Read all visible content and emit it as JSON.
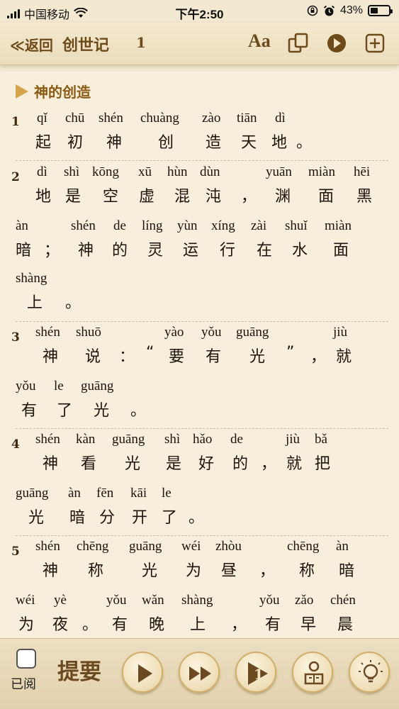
{
  "status_bar": {
    "carrier": "中国移动",
    "time": "下午2:50",
    "battery": "43%",
    "battery_level": 0.43
  },
  "nav": {
    "back_label": "≪返回",
    "book_name": "创世记",
    "chapter": "1",
    "font_label": "Aa"
  },
  "section_title": "神的创造",
  "verses": [
    {
      "num": "1",
      "lines": [
        {
          "py": [
            "qǐ",
            "chū",
            "shén",
            "chuàng",
            "zào",
            "tiān",
            "dì"
          ],
          "hz": [
            "起",
            "初",
            "神",
            "创",
            "造",
            "天",
            "地",
            "。"
          ]
        }
      ]
    },
    {
      "num": "2",
      "lines": [
        {
          "py": [
            "dì",
            "shì",
            "kōng",
            "xū",
            "hùn",
            "dùn",
            "yuān",
            "miàn",
            "hēi"
          ],
          "hz": [
            "地",
            "是",
            "空",
            "虚",
            "混",
            "沌",
            "，",
            "渊",
            "面",
            "黑"
          ]
        },
        {
          "py": [
            "àn",
            "shén",
            "de",
            "líng",
            "yùn",
            "xíng",
            "zài",
            "shuǐ",
            "miàn"
          ],
          "hz": [
            "暗",
            "；",
            "神",
            "的",
            "灵",
            "运",
            "行",
            "在",
            "水",
            "面"
          ]
        },
        {
          "py": [
            "shàng"
          ],
          "hz": [
            "上",
            "。"
          ]
        }
      ]
    },
    {
      "num": "3",
      "lines": [
        {
          "py": [
            "shén",
            "shuō",
            "yào",
            "yǒu",
            "guāng",
            "jiù"
          ],
          "hz": [
            "神",
            "说",
            "：",
            "“",
            "要",
            "有",
            "光",
            "”",
            "，",
            "就"
          ]
        },
        {
          "py": [
            "yǒu",
            "le",
            "guāng"
          ],
          "hz": [
            "有",
            "了",
            "光",
            "。"
          ]
        }
      ]
    },
    {
      "num": "4",
      "lines": [
        {
          "py": [
            "shén",
            "kàn",
            "guāng",
            "shì",
            "hǎo",
            "de",
            "jiù",
            "bǎ"
          ],
          "hz": [
            "神",
            "看",
            "光",
            "是",
            "好",
            "的",
            "，",
            "就",
            "把"
          ]
        },
        {
          "py": [
            "guāng",
            "àn",
            "fēn",
            "kāi",
            "le"
          ],
          "hz": [
            "光",
            "暗",
            "分",
            "开",
            "了",
            "。"
          ]
        }
      ]
    },
    {
      "num": "5",
      "lines": [
        {
          "py": [
            "shén",
            "chēng",
            "guāng",
            "wéi",
            "zhòu",
            "chēng",
            "àn"
          ],
          "hz": [
            "神",
            "称",
            "光",
            "为",
            "昼",
            "，",
            "称",
            "暗"
          ]
        },
        {
          "py": [
            "wéi",
            "yè",
            "yǒu",
            "wǎn",
            "shàng",
            "yǒu",
            "zǎo",
            "chén"
          ],
          "hz": [
            "为",
            "夜",
            "。",
            "有",
            "晚",
            "上",
            "，",
            "有",
            "早",
            "晨"
          ]
        }
      ]
    }
  ],
  "toolbar": {
    "read_label": "已阅",
    "summary_label": "提要",
    "chapter_badge": "1"
  },
  "colors": {
    "background": "#f7eedb",
    "accent_brown": "#6e4a19",
    "section_title": "#8a5a12",
    "button_gold": "#d2b06a"
  },
  "icons": [
    "wifi-icon",
    "lock-rotation-icon",
    "alarm-icon",
    "copy-icon",
    "play-icon",
    "add-icon",
    "fast-forward-icon",
    "reader-icon",
    "lightbulb-icon"
  ]
}
